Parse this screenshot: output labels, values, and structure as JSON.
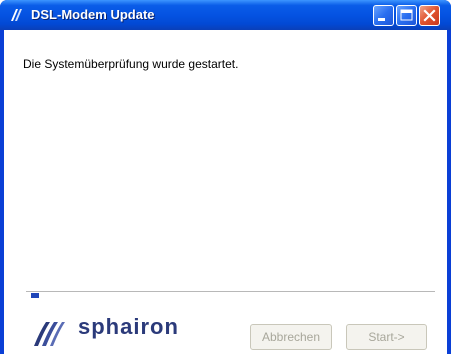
{
  "window": {
    "title": "DSL-Modem Update",
    "icon": "modem-app-icon",
    "controls": [
      "minimize-icon",
      "maximize-icon",
      "close-icon"
    ],
    "accent_color": "#0553e2"
  },
  "content": {
    "status_text": "Die Systemüberprüfung wurde gestartet.",
    "progress_percent": 2
  },
  "footer": {
    "brand": "sphairon",
    "logo_icon": "sphairon-logo-icon",
    "cancel_label": "Abbrechen",
    "start_label": "Start->"
  }
}
